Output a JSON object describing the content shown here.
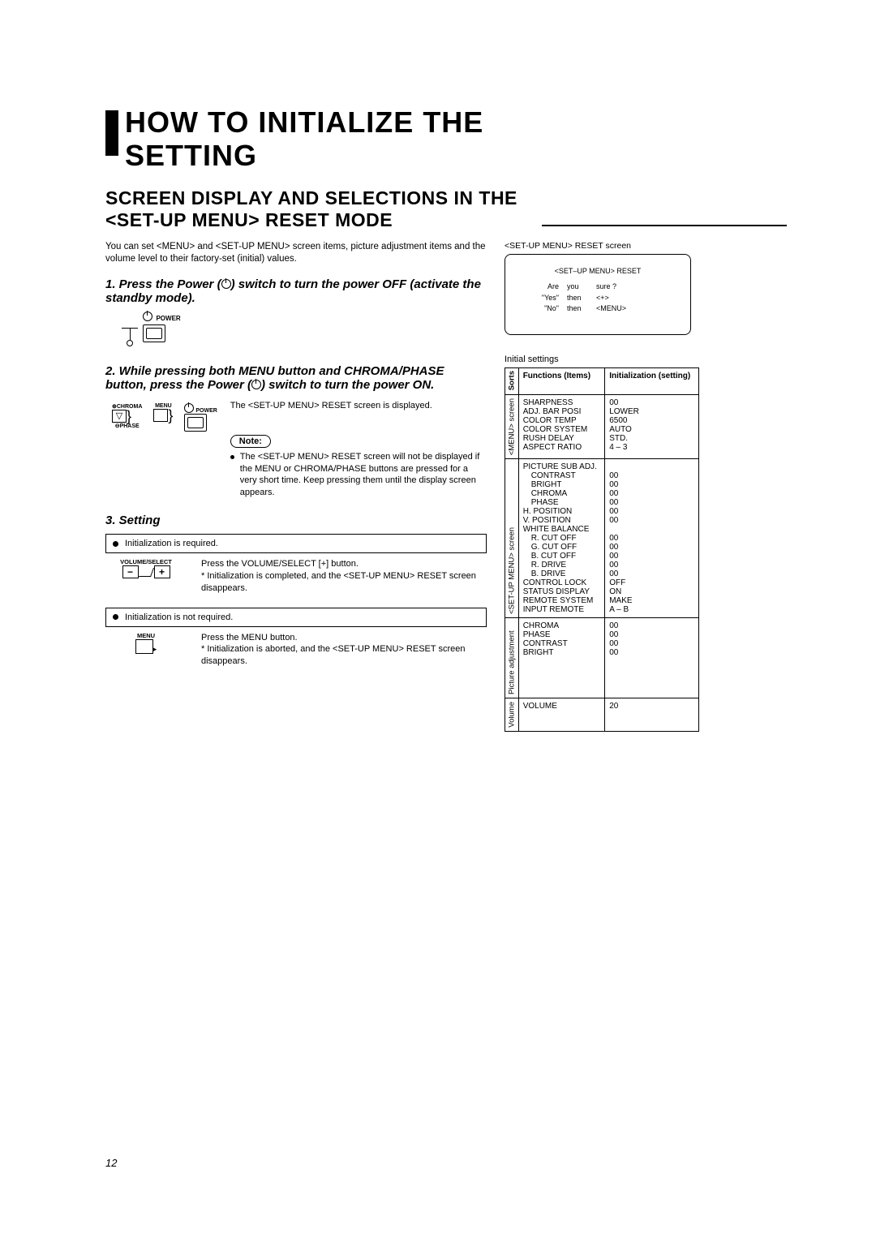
{
  "title": {
    "line1": "HOW TO INITIALIZE THE",
    "line2": "SETTING"
  },
  "subtitle": {
    "line1": "SCREEN DISPLAY AND SELECTIONS IN THE",
    "line2": "<SET-UP MENU> RESET MODE"
  },
  "intro": "You can set <MENU> and <SET-UP MENU> screen items, picture adjustment items and the volume level to their factory-set (initial) values.",
  "steps": {
    "s1": "1. Press the Power (   ) switch to turn the power OFF (activate the standby mode).",
    "s2": "2. While pressing both MENU button and CHROMA/PHASE button, press the Power (   ) switch to turn the power ON.",
    "s2_sub": "The <SET-UP MENU> RESET screen is displayed.",
    "note_label": "Note:",
    "note_body": "The <SET-UP MENU> RESET screen will not be displayed if the MENU or CHROMA/PHASE buttons are pressed for a very short time. Keep pressing them until the display screen appears.",
    "s3": "3. Setting"
  },
  "labels": {
    "power": "POWER",
    "chroma": "CHROMA",
    "menu": "MENU",
    "phase": "PHASE",
    "volume_select": "VOLUME/SELECT"
  },
  "setting": {
    "req": "Initialization is required.",
    "req_text1": "Press the VOLUME/SELECT [+] button.",
    "req_text2": "* Initialization is completed, and the <SET-UP MENU> RESET screen disappears.",
    "notreq": "Initialization is not required.",
    "notreq_text1": "Press the MENU button.",
    "notreq_text2": "* Initialization is aborted, and the <SET-UP MENU> RESET screen disappears."
  },
  "right": {
    "screen_caption": "<SET-UP MENU>  RESET screen",
    "screen_heading": "<SET–UP MENU> RESET",
    "screen_r1a": "Are",
    "screen_r1b": "you",
    "screen_r1c": "sure ?",
    "screen_r2a": "\"Yes\"",
    "screen_r2b": "then",
    "screen_r2c": "<+>",
    "screen_r3a": "\"No\"",
    "screen_r3b": "then",
    "screen_r3c": "<MENU>",
    "table_title": "Initial settings",
    "th_sorts": "Sorts",
    "th_func": "Functions (Items)",
    "th_init": "Initialization (setting)",
    "group1": "<MENU> screen",
    "group2": "<SET-UP MENU> screen",
    "group3": "Picture adjustment",
    "group4": "Volume",
    "g1_items": "SHARPNESS\nADJ. BAR POSI\nCOLOR TEMP\nCOLOR SYSTEM\nRUSH DELAY\nASPECT RATIO",
    "g1_vals": "00\nLOWER\n6500\nAUTO\nSTD.\n4 – 3",
    "g2_items": "PICTURE SUB ADJ.\n CONTRAST\n BRIGHT\n CHROMA\n PHASE\nH. POSITION\nV. POSITION\nWHITE BALANCE\n R. CUT OFF\n G. CUT OFF\n B. CUT OFF\n R. DRIVE\n B. DRIVE\nCONTROL LOCK\nSTATUS DISPLAY\nREMOTE SYSTEM\nINPUT REMOTE",
    "g2_vals": "\n00\n00\n00\n00\n00\n00\n\n00\n00\n00\n00\n00\nOFF\nON\nMAKE\nA – B",
    "g3_items": "CHROMA\nPHASE\nCONTRAST\nBRIGHT",
    "g3_vals": "00\n00\n00\n00",
    "g4_items": "VOLUME",
    "g4_vals": "20"
  },
  "page_number": "12"
}
